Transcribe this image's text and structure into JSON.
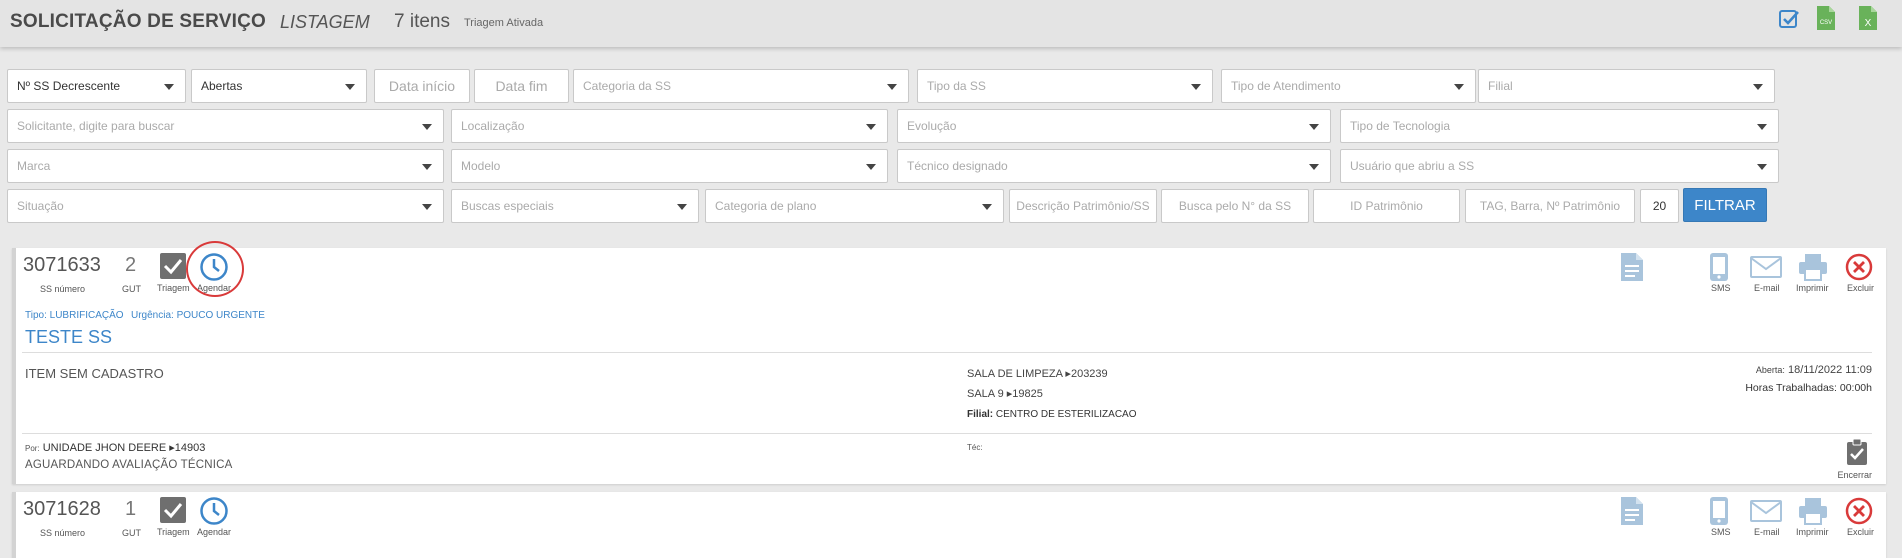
{
  "header": {
    "title": "SOLICITAÇÃO DE SERVIÇO",
    "subtitle": "LISTAGEM",
    "count": "7 itens",
    "triage": "Triagem Ativada",
    "icons": [
      "check-square-icon",
      "csv-file-icon",
      "excel-file-icon"
    ],
    "csv_label": "CSV",
    "excel_label": "X"
  },
  "filters": {
    "order": "Nº SS Decrescente",
    "status": "Abertas",
    "date_start": "Data início",
    "date_end": "Data fim",
    "category": "Categoria da SS",
    "type": "Tipo da SS",
    "attendance": "Tipo de Atendimento",
    "branch": "Filial",
    "requester": "Solicitante, digite para buscar",
    "location": "Localização",
    "evolution": "Evolução",
    "tech_type": "Tipo de Tecnologia",
    "brand": "Marca",
    "model": "Modelo",
    "technician": "Técnico designado",
    "opened_by": "Usuário que abriu a SS",
    "situation": "Situação",
    "special": "Buscas especiais",
    "plan_category": "Categoria de plano",
    "description": "Descrição Patrimônio/SS",
    "ss_number": "Busca pelo N° da SS",
    "asset_id": "ID Patrimônio",
    "tag": "TAG, Barra, Nº Patrimônio",
    "per_page": "20",
    "submit": "FILTRAR"
  },
  "labels": {
    "ss": "SS número",
    "gut": "GUT",
    "triagem": "Triagem",
    "agendar": "Agendar",
    "sms": "SMS",
    "email": "E-mail",
    "imprimir": "Imprimir",
    "excluir": "Excluir",
    "encerrar": "Encerrar",
    "aberta": "Aberta:",
    "por": "Por:",
    "tec": "Téc:",
    "horas": "Horas Trabalhadas:"
  },
  "cards": [
    {
      "number": "3071633",
      "gut": "2",
      "type": "Tipo: LUBRIFICAÇÃO",
      "urgency": "Urgência: POUCO URGENTE",
      "title": "TESTE SS",
      "item": "ITEM SEM CADASTRO",
      "loc1": "SALA DE LIMPEZA ▸203239",
      "loc2": "SALA 9 ▸19825",
      "filial_label": "Filial:",
      "filial": "CENTRO DE ESTERILIZACAO",
      "opened": "18/11/2022 11:09",
      "hours": "00:00h",
      "by": "UNIDADE JHON DEERE ▸14903",
      "status": "AGUARDANDO AVALIAÇÃO TÉCNICA"
    },
    {
      "number": "3071628",
      "gut": "1"
    }
  ],
  "colors": {
    "accent": "#3d86c9",
    "danger": "#d93a3a",
    "muted_icon": "#a9c4dc",
    "csv_green": "#69b25a"
  }
}
